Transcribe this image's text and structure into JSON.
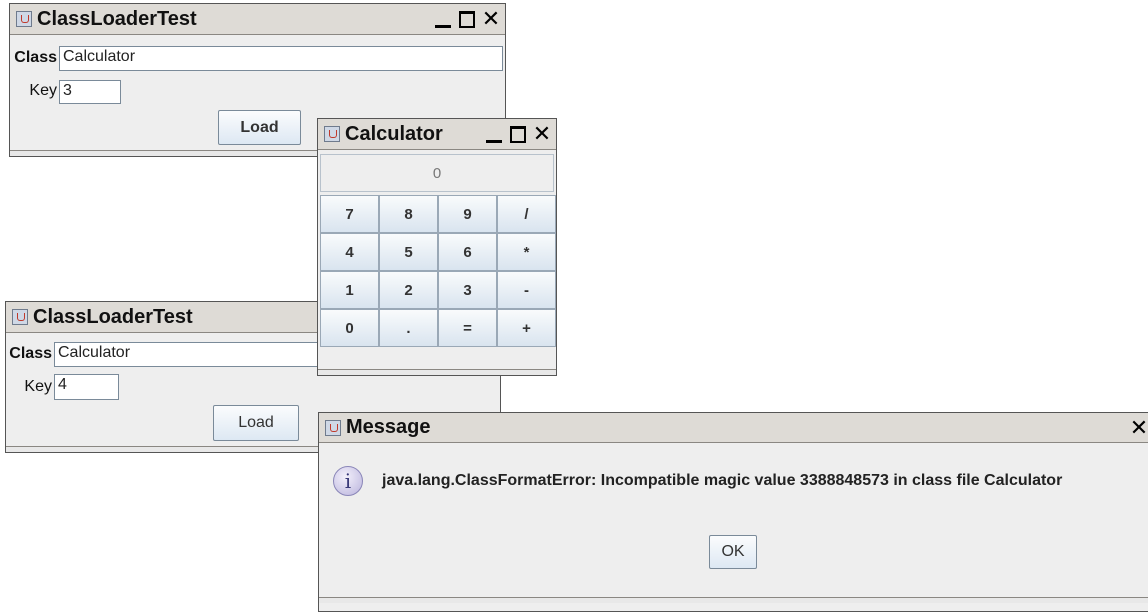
{
  "window1": {
    "title": "ClassLoaderTest",
    "class_label": "Class",
    "class_value": "Calculator",
    "key_label": "Key",
    "key_value": "3",
    "load_label": "Load"
  },
  "calculator": {
    "title": "Calculator",
    "display": "0",
    "keys": [
      "7",
      "8",
      "9",
      "/",
      "4",
      "5",
      "6",
      "*",
      "1",
      "2",
      "3",
      "-",
      "0",
      ".",
      "=",
      "+"
    ]
  },
  "window2": {
    "title": "ClassLoaderTest",
    "class_label": "Class",
    "class_value": "Calculator",
    "key_label": "Key",
    "key_value": "4",
    "load_label": "Load"
  },
  "message": {
    "title": "Message",
    "text": "java.lang.ClassFormatError: Incompatible magic value 3388848573 in class file Calculator",
    "ok_label": "OK"
  },
  "icons": {
    "window_icon": "java-coffee-cup-icon",
    "minimize": "minimize-icon",
    "maximize": "maximize-icon",
    "close": "close-icon",
    "info": "information-icon"
  }
}
